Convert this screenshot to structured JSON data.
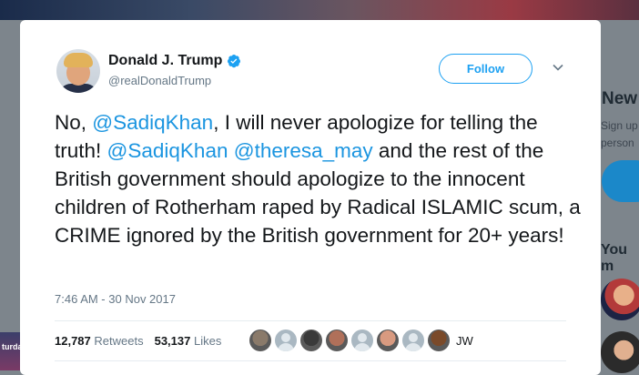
{
  "background": {
    "left_banner_text": "turda",
    "sidebar": {
      "heading": "New",
      "signup_lines": [
        "Sign up",
        "person"
      ],
      "section_heading": "You m"
    }
  },
  "tweet": {
    "author_name": "Donald J. Trump",
    "author_handle": "@realDonaldTrump",
    "verified": true,
    "follow_label": "Follow",
    "text_segments": [
      {
        "text": "No, ",
        "type": "text"
      },
      {
        "text": "@SadiqKhan",
        "type": "mention"
      },
      {
        "text": ", I will never apologize for telling the truth! ",
        "type": "text"
      },
      {
        "text": "@SadiqKhan",
        "type": "mention"
      },
      {
        "text": " ",
        "type": "text"
      },
      {
        "text": "@theresa_may",
        "type": "mention"
      },
      {
        "text": " and the rest of the British government should apologize to the innocent children of Rotherham raped by Radical ISLAMIC scum, a CRIME ignored by the British government for 20+ years!",
        "type": "text"
      }
    ],
    "timestamp": "7:46 AM - 30 Nov 2017",
    "retweets_count": "12,787",
    "retweets_label": "Retweets",
    "likes_count": "53,137",
    "likes_label": "Likes",
    "likers": [
      {
        "icon": "liker-photo",
        "color": "#8a7a6a"
      },
      {
        "icon": "default-avatar-icon",
        "color": "#aab8c2"
      },
      {
        "icon": "liker-photo",
        "color": "#3a3a3a"
      },
      {
        "icon": "liker-photo",
        "color": "#b0705a"
      },
      {
        "icon": "default-avatar-icon",
        "color": "#aab8c2"
      },
      {
        "icon": "liker-photo",
        "color": "#d89a80"
      },
      {
        "icon": "default-avatar-icon",
        "color": "#aab8c2"
      },
      {
        "icon": "liker-photo",
        "color": "#7a4a2a"
      }
    ],
    "likers_more": "JW"
  },
  "colors": {
    "accent": "#1da1f2",
    "mention": "#1b95e0",
    "text": "#14171a",
    "muted": "#657786"
  }
}
